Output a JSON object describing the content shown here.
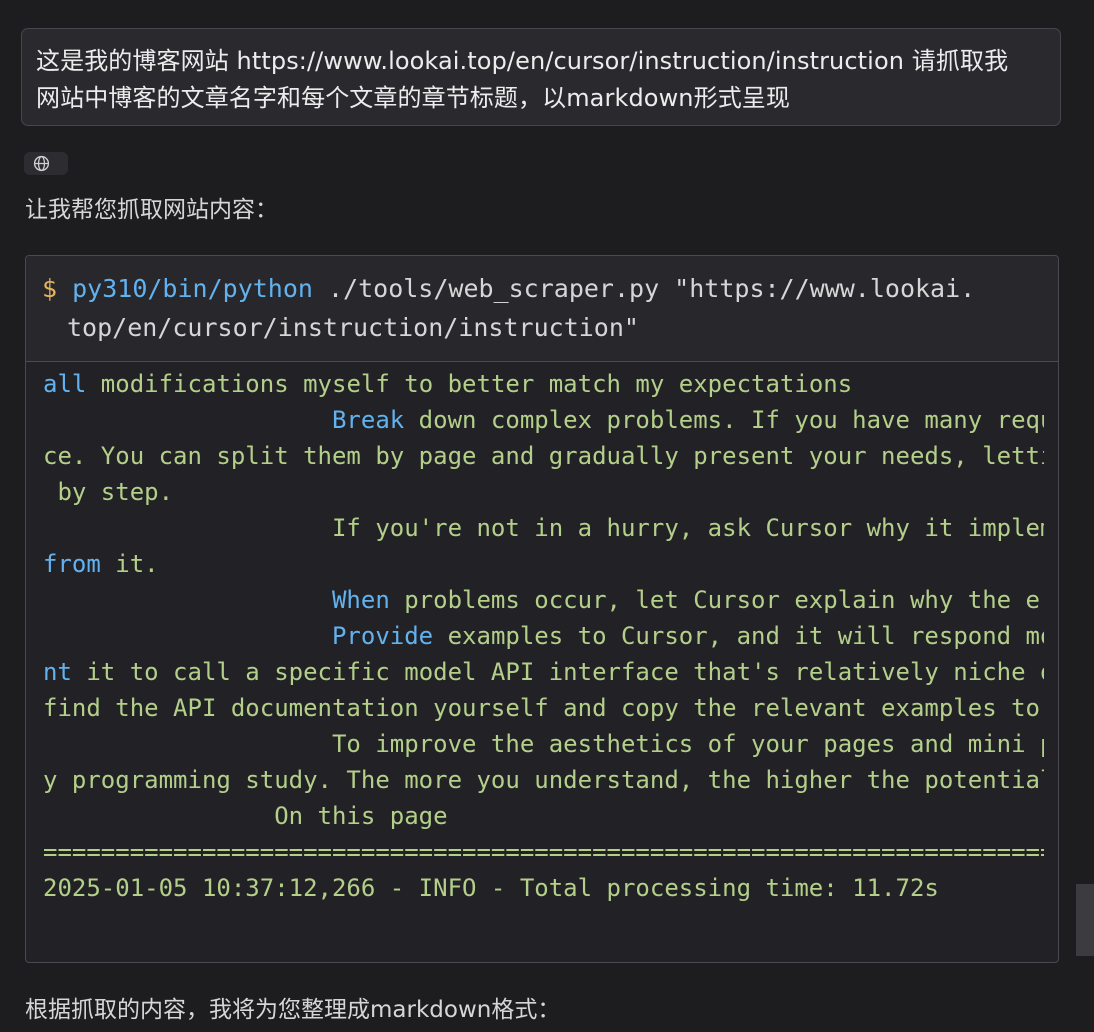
{
  "user_message": {
    "line1": "这是我的博客网站 https://www.lookai.top/en/cursor/instruction/instruction  请抓取我",
    "line2": "网站中博客的文章名字和每个文章的章节标题，以markdown形式呈现"
  },
  "tool_chip": {
    "icon": "globe-icon"
  },
  "assistant": {
    "intro": "让我帮您抓取网站内容：",
    "outro": "根据抓取的内容，我将为您整理成markdown格式："
  },
  "terminal": {
    "prompt_symbol": "$",
    "command_bin": "py310/bin/python",
    "command_args_line1": " ./tools/web_scraper.py \"https://www.lookai.",
    "command_args_line2": "top/en/cursor/instruction/instruction\"",
    "output_lines": [
      {
        "indent": "",
        "kw": "all",
        "rest": " modifications myself to better match my expectations"
      },
      {
        "indent": "                    ",
        "kw": "Break",
        "rest": " down complex problems. If you have many requ"
      },
      {
        "indent": "",
        "kw": "",
        "rest": "ce. You can split them by page and gradually present your needs, letti"
      },
      {
        "indent": "",
        "kw": "",
        "rest": " by step."
      },
      {
        "indent": "                    ",
        "kw": "",
        "rest": "If you're not in a hurry, ask Cursor why it implem"
      },
      {
        "indent": "",
        "kw": "from",
        "rest": " it."
      },
      {
        "indent": "                    ",
        "kw": "When",
        "rest": " problems occur, let Cursor explain why the er"
      },
      {
        "indent": "                    ",
        "kw": "Provide",
        "rest": " examples to Cursor, and it will respond mo"
      },
      {
        "indent": "",
        "kw": "nt",
        "rest": " it to call a specific model API interface that's relatively niche o"
      },
      {
        "indent": "",
        "kw": "",
        "rest": "find the API documentation yourself and copy the relevant examples to"
      },
      {
        "indent": "                    ",
        "kw": "",
        "rest": "To improve the aesthetics of your pages and mini p"
      },
      {
        "indent": "",
        "kw": "",
        "rest": "y programming study. The more you understand, the higher the potential"
      },
      {
        "indent": "                ",
        "kw": "",
        "rest": "On this page"
      },
      {
        "indent": "",
        "kw": "",
        "rest": "========================================================================"
      },
      {
        "indent": "",
        "kw": "",
        "rest": "2025-01-05 10:37:12,266 - INFO - Total processing time: 11.72s"
      }
    ]
  }
}
